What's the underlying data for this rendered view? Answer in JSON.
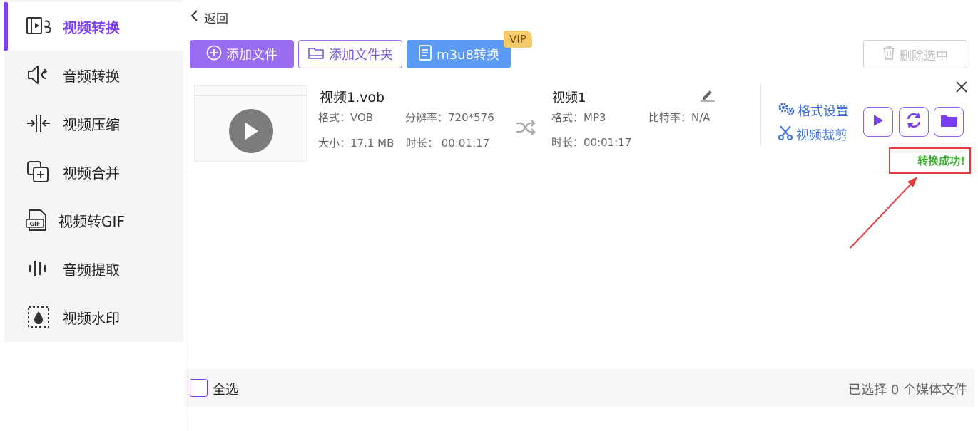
{
  "sidebar": {
    "items": [
      {
        "label": "视频转换",
        "icon": "video-convert-icon",
        "active": true
      },
      {
        "label": "音频转换",
        "icon": "audio-convert-icon"
      },
      {
        "label": "视频压缩",
        "icon": "compress-icon"
      },
      {
        "label": "视频合并",
        "icon": "merge-icon"
      },
      {
        "label": "视频转GIF",
        "icon": "gif-icon"
      },
      {
        "label": "音频提取",
        "icon": "audio-extract-icon"
      },
      {
        "label": "视频水印",
        "icon": "watermark-icon"
      }
    ]
  },
  "header": {
    "back_label": "返回"
  },
  "toolbar": {
    "add_file_label": "添加文件",
    "add_folder_label": "添加文件夹",
    "m3u8_label": "m3u8转换",
    "vip_label": "VIP",
    "delete_label": "删除选中"
  },
  "file": {
    "source": {
      "name": "视频1.vob",
      "format": "格式：VOB",
      "resolution": "分辨率：720*576",
      "size": "大小：17.1 MB",
      "duration": "时长：  00:01:17"
    },
    "output": {
      "name": "视频1",
      "format": "格式：MP3",
      "bitrate": "比特率：N/A",
      "duration": "时长：00:01:17"
    },
    "format_settings_label": "格式设置",
    "video_cut_label": "视频裁剪",
    "status_label": "转换成功!"
  },
  "footer": {
    "select_all_label": "全选",
    "selected_status": "已选择 0 个媒体文件"
  },
  "colors": {
    "accent": "#7b3ff2",
    "primary_button": "#9a6cf0",
    "m3u8_button": "#5b9af5",
    "vip": "#f6c96c",
    "link": "#3d6fd8",
    "success": "#3fae32",
    "highlight_box": "#e03e3e"
  }
}
